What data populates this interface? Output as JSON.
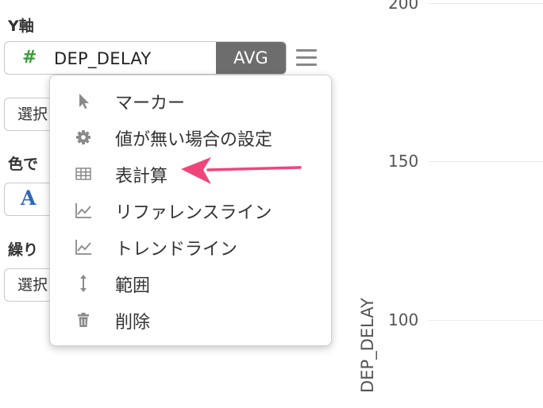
{
  "panel": {
    "y_axis_label": "Y軸",
    "field": {
      "type_icon": "#",
      "name": "DEP_DELAY",
      "aggregation": "AVG"
    },
    "select_1_text": "選択",
    "color_label": "色で",
    "color_glyph": "A",
    "repeat_label": "繰り",
    "select_2_text": "選択"
  },
  "menu": {
    "items": [
      {
        "icon": "cursor-icon",
        "label": "マーカー"
      },
      {
        "icon": "gear-icon",
        "label": "値が無い場合の設定"
      },
      {
        "icon": "table-icon",
        "label": "表計算"
      },
      {
        "icon": "line-chart-icon",
        "label": "リファレンスライン"
      },
      {
        "icon": "line-chart-icon",
        "label": "トレンドライン"
      },
      {
        "icon": "vertical-arrows-icon",
        "label": "範囲"
      },
      {
        "icon": "trash-icon",
        "label": "削除"
      }
    ]
  },
  "chart": {
    "y_ticks": [
      "200",
      "150",
      "100"
    ],
    "y_axis_title": "DEP_DELAY"
  },
  "annotation": {
    "arrow_color": "#f0457a"
  },
  "colors": {
    "field_type": "#3a9d3a",
    "aggregation_bg": "#6d6d6d",
    "color_glyph": "#2f67b8"
  }
}
